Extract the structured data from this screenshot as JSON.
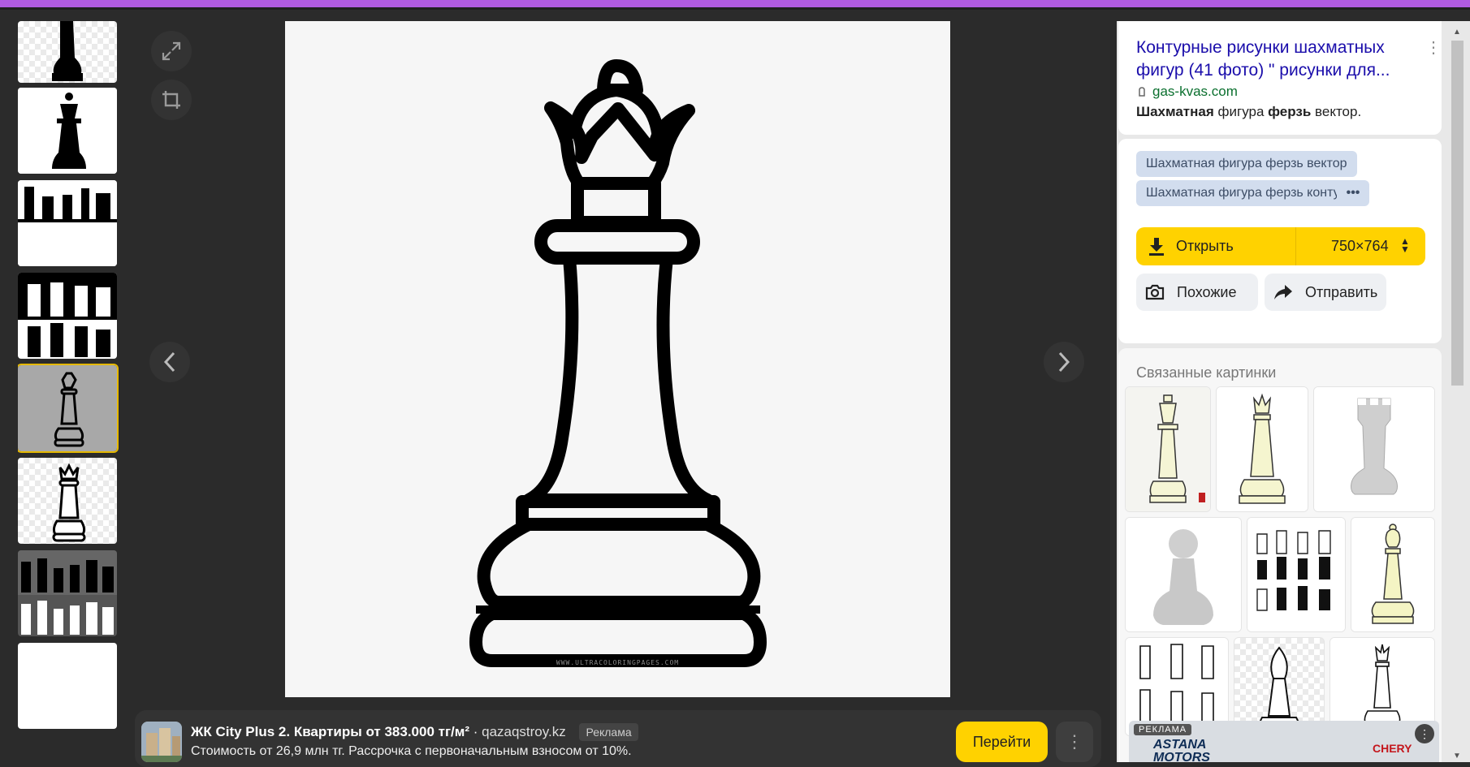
{
  "side": {
    "title": "Контурные рисунки шахматных фигур (41 фото) \" рисунки для...",
    "host": "gas-kvas.com",
    "snippet_b1": "Шахматная",
    "snippet_t1": " фигура ",
    "snippet_b2": "ферзь",
    "snippet_t2": " вектор.",
    "tags": [
      "Шахматная фигура ферзь вектор",
      "Шахматная фигура ферзь контур"
    ],
    "open_label": "Открыть",
    "size_label": "750×764",
    "similar_label": "Похожие",
    "share_label": "Отправить",
    "related_title": "Связанные картинки"
  },
  "ad": {
    "title": "ЖК City Plus 2. Квартиры от 383.000 тг/м²",
    "separator": " · ",
    "domain": "qazaqstroy.kz",
    "badge": "Реклама",
    "description": "Стоимость от 26,9 млн тг. Рассрочка с первоначальным взносом от 10%.",
    "go_label": "Перейти"
  },
  "main_image": {
    "watermark": "WWW.ULTRACOLORINGPAGES.COM"
  },
  "side_ad": {
    "label": "РЕКЛАМА",
    "brand_line1": "ASTANA",
    "brand_line2": "MOTORS",
    "brand2": "CHERY"
  },
  "colors": {
    "accent": "#ffd200",
    "link": "#1a0dab",
    "host": "#0a6f2e",
    "topbar": "#b05be0"
  },
  "icons": [
    "expand-icon",
    "crop-icon",
    "chevron-left-icon",
    "chevron-right-icon",
    "download-icon",
    "camera-search-icon",
    "share-arrow-icon",
    "kebab-icon"
  ]
}
